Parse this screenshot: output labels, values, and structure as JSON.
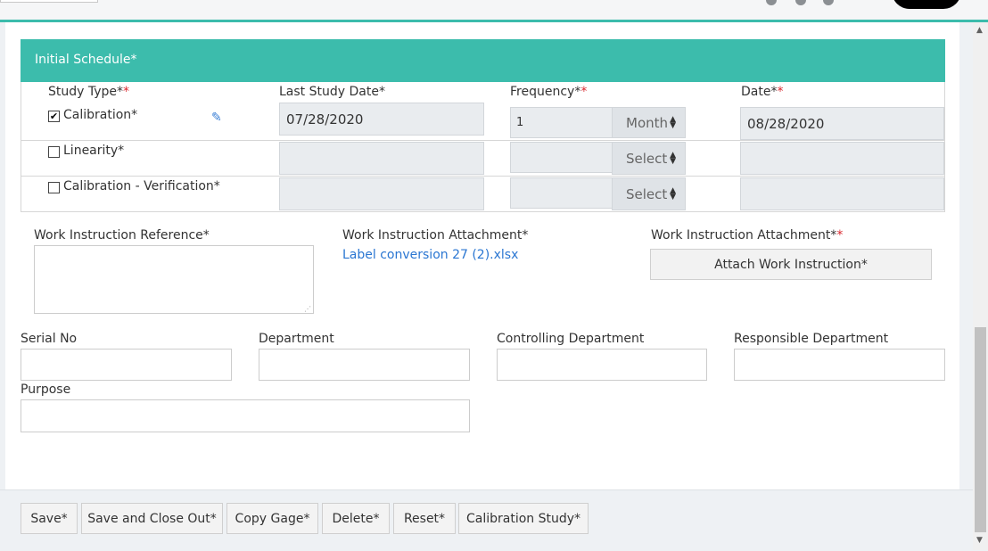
{
  "panel": {
    "title": "Initial Schedule*"
  },
  "schedule": {
    "headers": {
      "study_type": "Study Type*",
      "study_type_mark": "*",
      "last_study_date": "Last Study Date*",
      "frequency": "Frequency*",
      "frequency_mark": "*",
      "date": "Date*",
      "date_mark": "*"
    },
    "rows": [
      {
        "label": "Calibration*",
        "checked": true,
        "check_glyph": "✔",
        "last_study_date": "07/28/2020",
        "frequency": "1",
        "unit": "Month",
        "date": "08/28/2020"
      },
      {
        "label": "Linearity*",
        "checked": false,
        "check_glyph": "",
        "last_study_date": "",
        "frequency": "",
        "unit": "Select",
        "date": ""
      },
      {
        "label": "Calibration - Verification*",
        "checked": false,
        "check_glyph": "",
        "last_study_date": "",
        "frequency": "",
        "unit": "Select",
        "date": ""
      }
    ],
    "edit_icon": "pencil-icon"
  },
  "work_instruction": {
    "reference_label": "Work Instruction Reference*",
    "reference_value": "",
    "attachment_label": "Work Instruction Attachment*",
    "attachment_file": "Label conversion 27 (2).xlsx",
    "attachment_label_2": "Work Instruction Attachment*",
    "attachment_mark_2": "*",
    "attach_button": "Attach Work Instruction*"
  },
  "fields": {
    "serial_no": {
      "label": "Serial No",
      "value": ""
    },
    "department": {
      "label": "Department",
      "value": ""
    },
    "controlling_department": {
      "label": "Controlling Department",
      "value": ""
    },
    "responsible_department": {
      "label": "Responsible Department",
      "value": ""
    },
    "purpose": {
      "label": "Purpose",
      "value": ""
    }
  },
  "footer": {
    "save": "Save*",
    "save_close": "Save and Close Out*",
    "copy_gage": "Copy Gage*",
    "delete": "Delete*",
    "reset": "Reset*",
    "calibration_study": "Calibration Study*"
  },
  "colors": {
    "accent": "#3cbcac",
    "required": "#d9272e",
    "link": "#2a76d2"
  }
}
